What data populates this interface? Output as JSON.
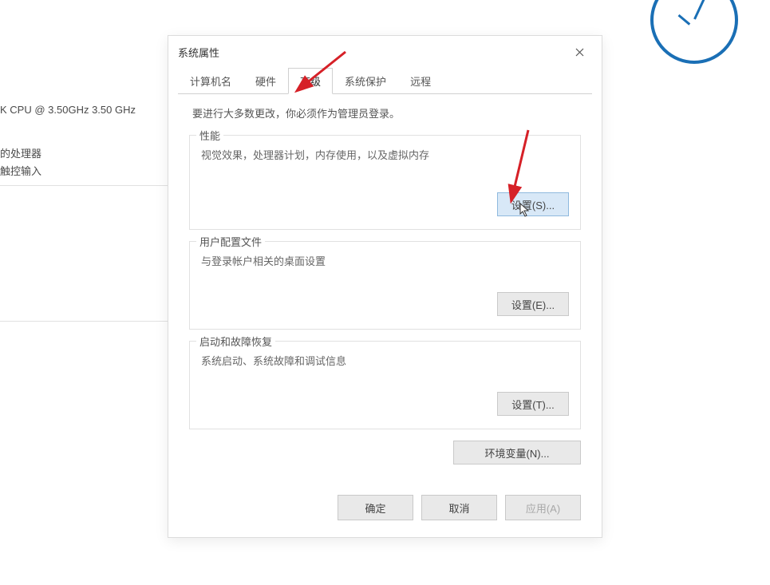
{
  "background": {
    "cpu_line": "K CPU @ 3.50GHz   3.50 GHz",
    "processor_line": "的处理器",
    "touch_line": "触控输入"
  },
  "dialog": {
    "title": "系统属性",
    "tabs": {
      "computer_name": "计算机名",
      "hardware": "硬件",
      "advanced": "高级",
      "system_protection": "系统保护",
      "remote": "远程"
    },
    "active_tab": "高级",
    "admin_required_text": "要进行大多数更改，你必须作为管理员登录。",
    "sections": {
      "performance": {
        "title": "性能",
        "desc": "视觉效果，处理器计划，内存使用，以及虚拟内存",
        "button": "设置(S)..."
      },
      "user_profiles": {
        "title": "用户配置文件",
        "desc": "与登录帐户相关的桌面设置",
        "button": "设置(E)..."
      },
      "startup_recovery": {
        "title": "启动和故障恢复",
        "desc": "系统启动、系统故障和调试信息",
        "button": "设置(T)..."
      }
    },
    "env_button": "环境变量(N)...",
    "buttons": {
      "ok": "确定",
      "cancel": "取消",
      "apply": "应用(A)"
    }
  }
}
